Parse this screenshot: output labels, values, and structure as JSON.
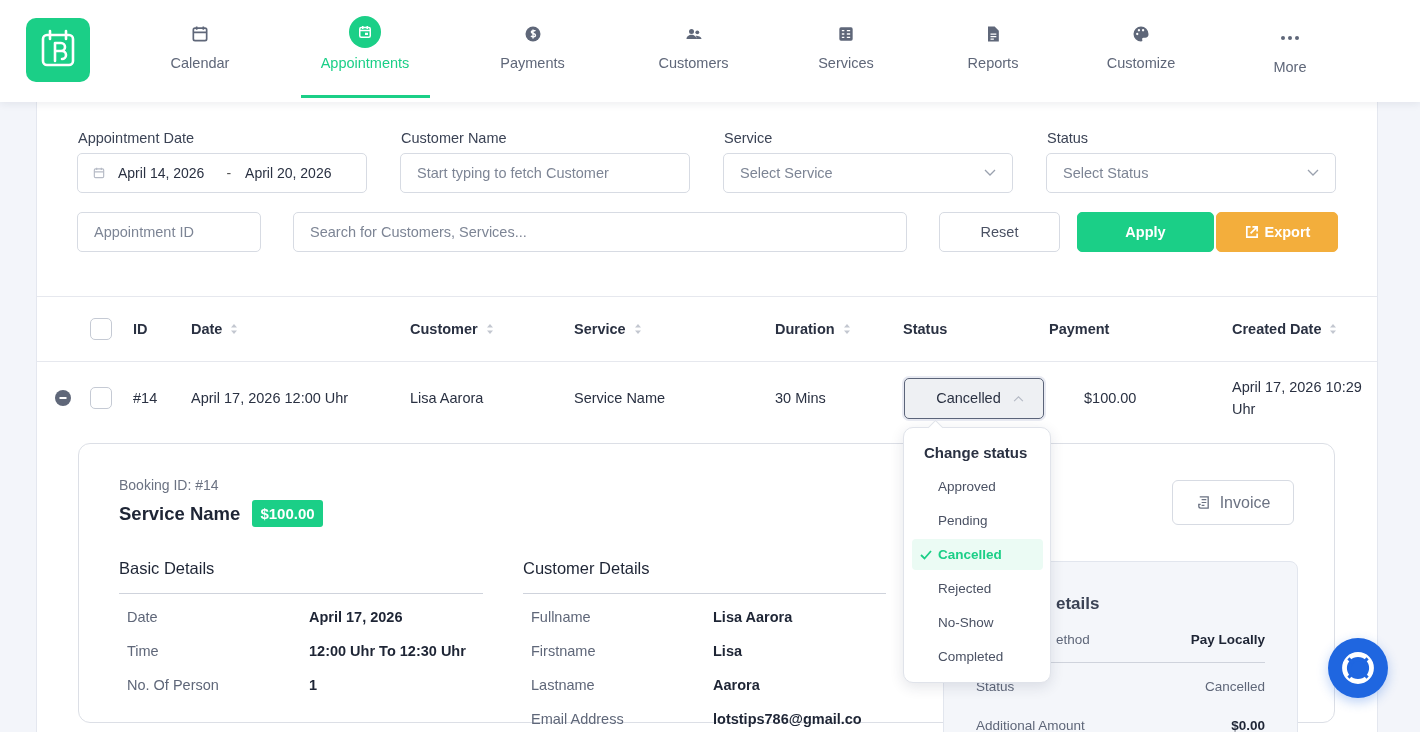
{
  "nav": {
    "items": [
      {
        "label": "Calendar",
        "selected": false
      },
      {
        "label": "Appointments",
        "selected": true
      },
      {
        "label": "Payments",
        "selected": false
      },
      {
        "label": "Customers",
        "selected": false
      },
      {
        "label": "Services",
        "selected": false
      },
      {
        "label": "Reports",
        "selected": false
      },
      {
        "label": "Customize",
        "selected": false
      },
      {
        "label": "More",
        "selected": false
      }
    ]
  },
  "filters": {
    "appointment_date": {
      "label": "Appointment Date",
      "from": "April 14, 2026",
      "separator": "-",
      "to": "April 20, 2026"
    },
    "customer_name": {
      "label": "Customer Name",
      "placeholder": "Start typing to fetch Customer"
    },
    "service": {
      "label": "Service",
      "placeholder": "Select Service"
    },
    "status": {
      "label": "Status",
      "placeholder": "Select Status"
    },
    "appointment_id": {
      "placeholder": "Appointment ID"
    },
    "search": {
      "placeholder": "Search for Customers, Services..."
    },
    "buttons": [
      {
        "label": "Reset",
        "kind": "outline"
      },
      {
        "label": "Apply",
        "kind": "primary"
      },
      {
        "label": "Export",
        "kind": "export"
      }
    ]
  },
  "table": {
    "columns": [
      {
        "label": "ID",
        "sortable": false
      },
      {
        "label": "Date",
        "sortable": true
      },
      {
        "label": "Customer",
        "sortable": true
      },
      {
        "label": "Service",
        "sortable": true
      },
      {
        "label": "Duration",
        "sortable": true
      },
      {
        "label": "Status",
        "sortable": false
      },
      {
        "label": "Payment",
        "sortable": false
      },
      {
        "label": "Created Date",
        "sortable": true
      }
    ],
    "all_checked": false,
    "rows": [
      {
        "id": "#14",
        "date": "April 17, 2026 12:00 Uhr",
        "customer": "Lisa Aarora",
        "service": "Service Name",
        "duration": "30 Mins",
        "status": "Cancelled",
        "payment": "$100.00",
        "created_date": "April 17, 2026 10:29 Uhr",
        "checked": false,
        "expanded": true
      }
    ]
  },
  "status_menu": {
    "title": "Change status",
    "options": [
      {
        "label": "Approved",
        "selected": false
      },
      {
        "label": "Pending",
        "selected": false
      },
      {
        "label": "Cancelled",
        "selected": true
      },
      {
        "label": "Rejected",
        "selected": false
      },
      {
        "label": "No-Show",
        "selected": false
      },
      {
        "label": "Completed",
        "selected": false
      }
    ]
  },
  "details": {
    "booking_id": "Booking ID: #14",
    "service_name": "Service Name",
    "amount": "$100.00",
    "invoice_button": "Invoice",
    "basic": {
      "title": "Basic Details",
      "rows": [
        {
          "label": "Date",
          "value": "April 17, 2026"
        },
        {
          "label": "Time",
          "value": "12:00 Uhr To 12:30 Uhr"
        },
        {
          "label": "No. Of Person",
          "value": "1"
        }
      ]
    },
    "customer": {
      "title": "Customer Details",
      "rows": [
        {
          "label": "Fullname",
          "value": "Lisa Aarora"
        },
        {
          "label": "Firstname",
          "value": "Lisa"
        },
        {
          "label": "Lastname",
          "value": "Aarora"
        },
        {
          "label": "Email Address",
          "value": "lotstips786@gmail.co"
        }
      ]
    },
    "payment": {
      "title": "etails",
      "rows": [
        {
          "label": "ethod",
          "value": "Pay Locally",
          "emphasis": true
        },
        {
          "label": "Status",
          "value": "Cancelled",
          "emphasis": false
        },
        {
          "label": "Additional Amount",
          "value": "$0.00",
          "emphasis": true
        }
      ]
    }
  }
}
